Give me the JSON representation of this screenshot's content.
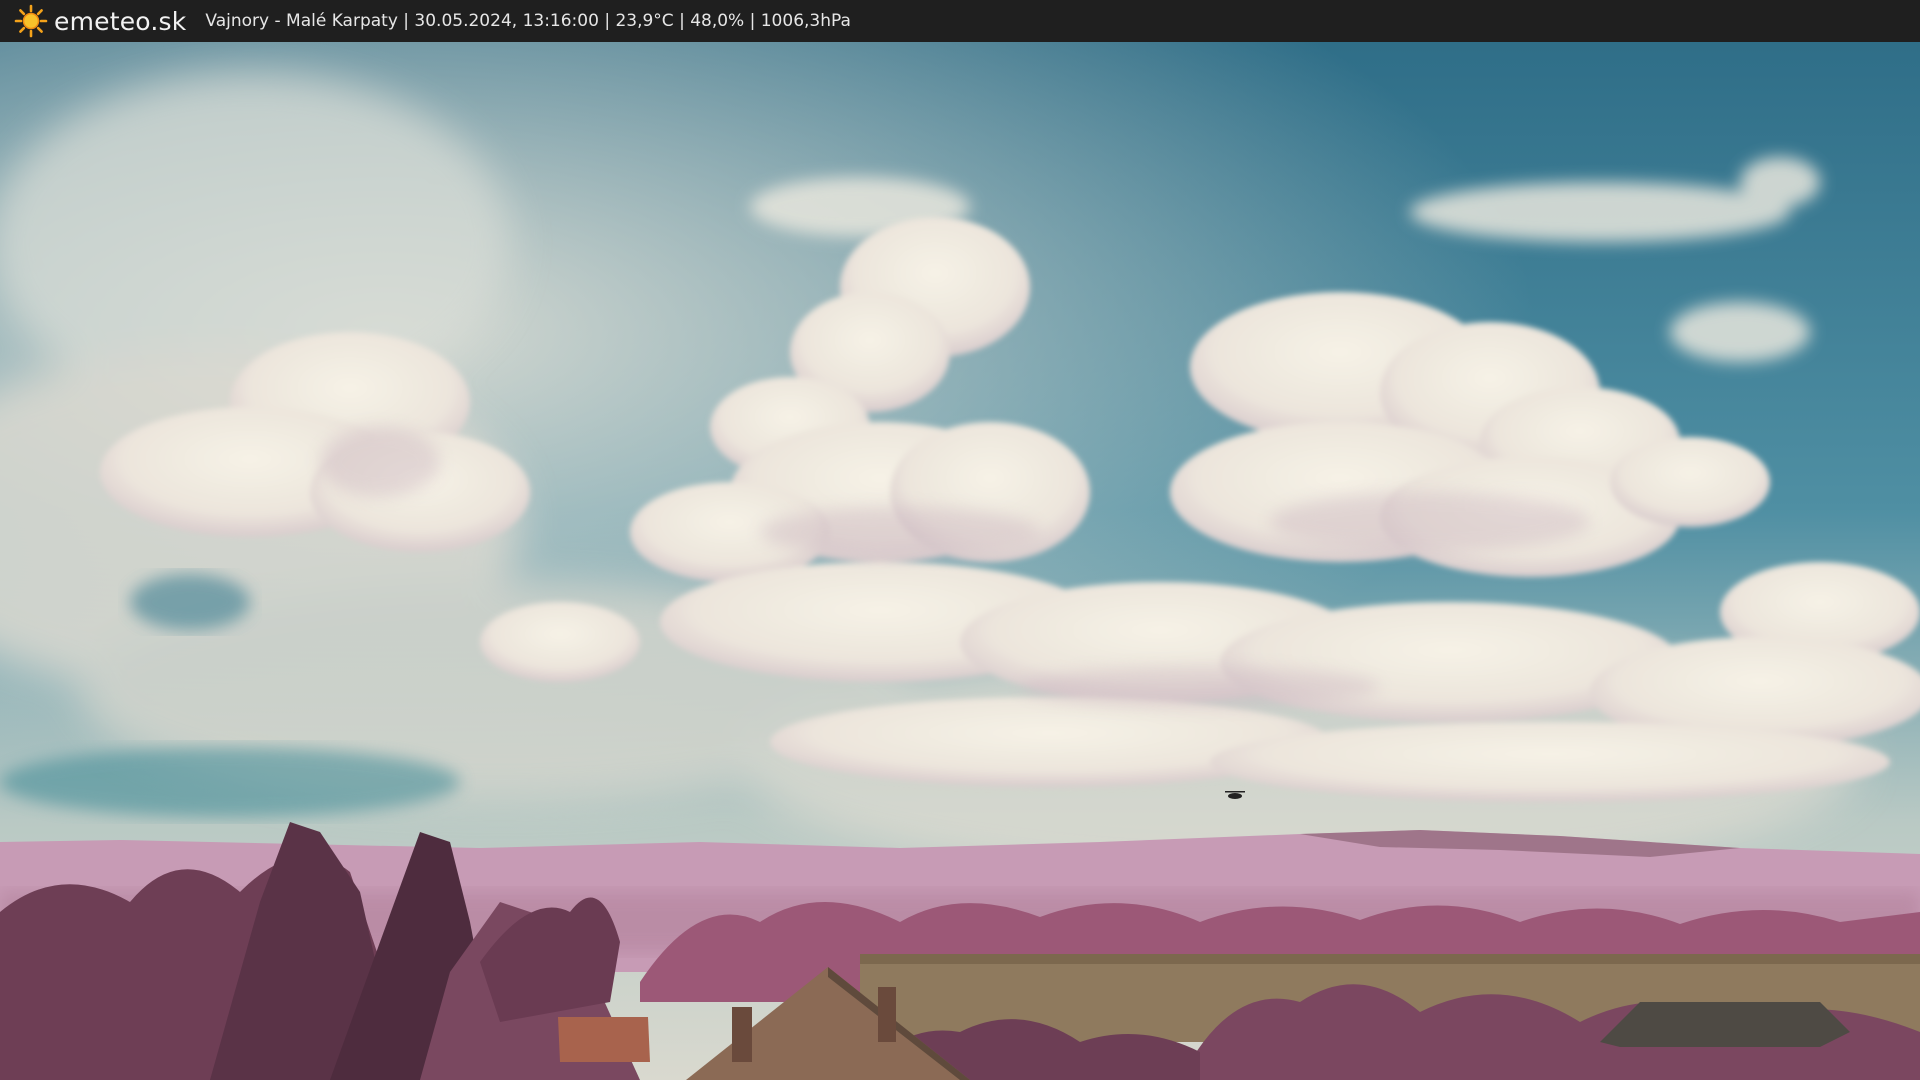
{
  "header": {
    "logo_icon": "sun-icon",
    "brand": "emeteo.sk",
    "caption": "Vajnory - Malé Karpaty | 30.05.2024, 13:16:00 | 23,9°C | 48,0% | 1006,3hPa",
    "background": "#1f1f1f"
  },
  "scene": {
    "type": "infrared webcam photo",
    "colors": {
      "sky": "#2e6c85",
      "cloud": "#eeeadf",
      "hills": "#c79bb5",
      "trees": "#8a4c68",
      "field": "#8f7a5e",
      "roof": "#8b6a55"
    }
  }
}
